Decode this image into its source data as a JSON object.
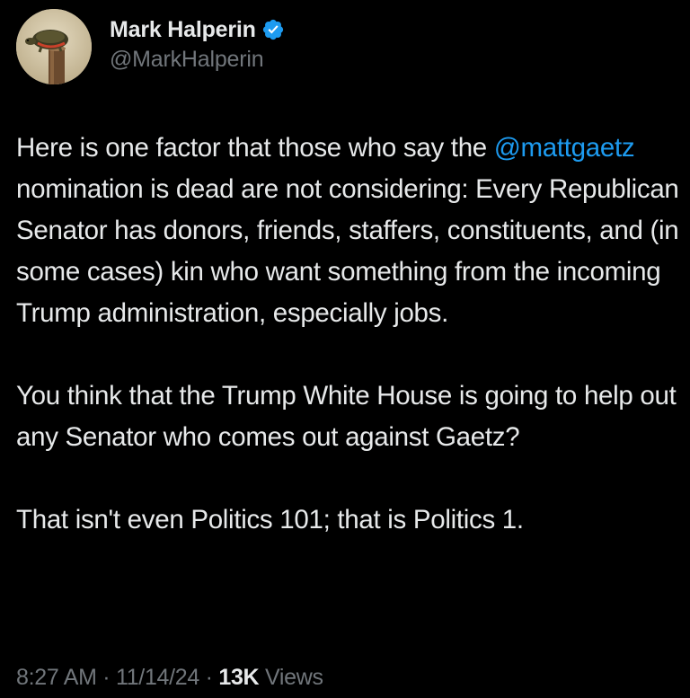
{
  "author": {
    "display_name": "Mark Halperin",
    "handle": "@MarkHalperin",
    "verified": true,
    "avatar_icon": "turtle-on-post-avatar",
    "verified_color": "#1d9bf0"
  },
  "tweet": {
    "paragraph1": {
      "mention": "@mattgaetz",
      "before_mention": "Here is one factor that those who say the ",
      "after_mention": " nomination is dead are not considering: Every Republican Senator has donors, friends, staffers, constituents, and (in some cases) kin who want something from the incoming Trump administration, especially jobs."
    },
    "paragraph2": "You think that the Trump White House is going to help out any Senator who comes out against Gaetz?",
    "paragraph3": "That isn't even Politics 101; that is Politics 1."
  },
  "meta": {
    "time": "8:27 AM",
    "separator": " · ",
    "date": "11/14/24",
    "views_count": "13K",
    "views_label": "Views"
  },
  "colors": {
    "background": "#000000",
    "text": "#e7e9ea",
    "muted": "#71767b",
    "link": "#1d9bf0"
  }
}
